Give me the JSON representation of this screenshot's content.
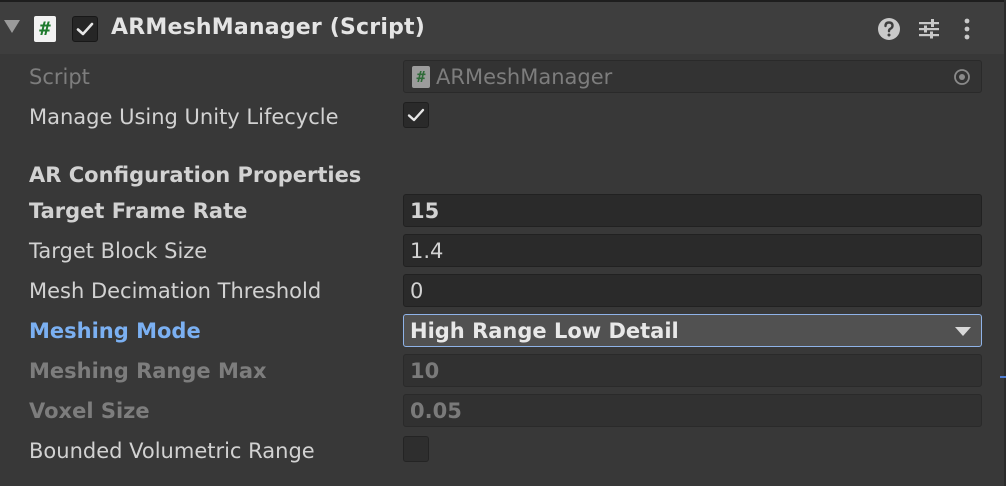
{
  "component": {
    "title": "ARMeshManager (Script)",
    "script_icon_glyph": "#",
    "enabled": true
  },
  "header_icons": [
    "help-icon",
    "presets-icon",
    "kebab-menu-icon"
  ],
  "fields": {
    "script": {
      "label": "Script",
      "value": "ARMeshManager",
      "icon_glyph": "#"
    },
    "manage_lifecycle": {
      "label": "Manage Using Unity Lifecycle",
      "checked": true
    },
    "section_header": "AR Configuration Properties",
    "target_frame_rate": {
      "label": "Target Frame Rate",
      "value": "15"
    },
    "target_block_size": {
      "label": "Target Block Size",
      "value": "1.4"
    },
    "mesh_decimation_threshold": {
      "label": "Mesh Decimation Threshold",
      "value": "0"
    },
    "meshing_mode": {
      "label": "Meshing Mode",
      "value": "High Range Low Detail"
    },
    "meshing_range_max": {
      "label": "Meshing Range Max",
      "value": "10"
    },
    "voxel_size": {
      "label": "Voxel Size",
      "value": "0.05"
    },
    "bounded_volumetric_range": {
      "label": "Bounded Volumetric Range",
      "checked": false
    }
  },
  "colors": {
    "background": "#383838",
    "header_background": "#3e3e3e",
    "field_background": "#2a2a2a",
    "focused_label": "#7bb0f2",
    "dropdown_border": "#8fb3e8"
  }
}
